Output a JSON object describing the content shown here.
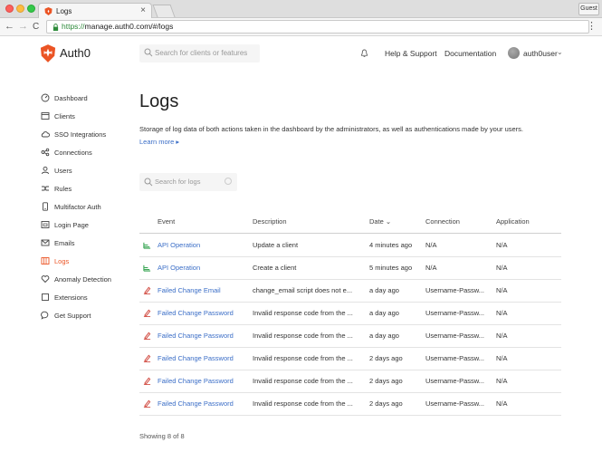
{
  "browser": {
    "tab_title": "Logs",
    "tab_close": "×",
    "guest_label": "Guest",
    "url_protocol": "https://",
    "url_rest": "manage.auth0.com/#/logs",
    "back": "←",
    "forward": "→",
    "reload": "C",
    "menu": "⋮",
    "lock": "🔒"
  },
  "header": {
    "logo_text": "Auth0",
    "search_placeholder": "Search for clients or features",
    "help_label": "Help & Support",
    "docs_label": "Documentation",
    "username": "auth0user",
    "user_chevron": "⌄"
  },
  "sidebar": {
    "items": [
      {
        "label": "Dashboard",
        "icon": "dashboard-icon"
      },
      {
        "label": "Clients",
        "icon": "clients-icon"
      },
      {
        "label": "SSO Integrations",
        "icon": "cloud-icon"
      },
      {
        "label": "Connections",
        "icon": "connections-icon"
      },
      {
        "label": "Users",
        "icon": "users-icon"
      },
      {
        "label": "Rules",
        "icon": "rules-icon"
      },
      {
        "label": "Multifactor Auth",
        "icon": "multifactor-icon"
      },
      {
        "label": "Login Page",
        "icon": "login-page-icon"
      },
      {
        "label": "Emails",
        "icon": "email-icon"
      },
      {
        "label": "Logs",
        "icon": "logs-icon",
        "active": true
      },
      {
        "label": "Anomaly Detection",
        "icon": "heart-icon"
      },
      {
        "label": "Extensions",
        "icon": "extensions-icon"
      },
      {
        "label": "Get Support",
        "icon": "chat-icon"
      }
    ]
  },
  "main": {
    "title": "Logs",
    "description": "Storage of log data of both actions taken in the dashboard by the administrators, as well as authentications made by your users.",
    "learn_more": "Learn more ▸",
    "search_placeholder": "Search for logs",
    "columns": {
      "event": "Event",
      "description": "Description",
      "date": "Date ⌄",
      "connection": "Connection",
      "application": "Application"
    },
    "rows": [
      {
        "type": "success",
        "event": "API Operation",
        "description": "Update a client",
        "date": "4 minutes ago",
        "connection": "N/A",
        "application": "N/A"
      },
      {
        "type": "success",
        "event": "API Operation",
        "description": "Create a client",
        "date": "5 minutes ago",
        "connection": "N/A",
        "application": "N/A"
      },
      {
        "type": "failure",
        "event": "Failed Change Email",
        "description": "change_email script does not e...",
        "date": "a day ago",
        "connection": "Username-Passw...",
        "application": "N/A"
      },
      {
        "type": "failure",
        "event": "Failed Change Password",
        "description": "Invalid response code from the ...",
        "date": "a day ago",
        "connection": "Username-Passw...",
        "application": "N/A"
      },
      {
        "type": "failure",
        "event": "Failed Change Password",
        "description": "Invalid response code from the ...",
        "date": "a day ago",
        "connection": "Username-Passw...",
        "application": "N/A"
      },
      {
        "type": "failure",
        "event": "Failed Change Password",
        "description": "Invalid response code from the ...",
        "date": "2 days ago",
        "connection": "Username-Passw...",
        "application": "N/A"
      },
      {
        "type": "failure",
        "event": "Failed Change Password",
        "description": "Invalid response code from the ...",
        "date": "2 days ago",
        "connection": "Username-Passw...",
        "application": "N/A"
      },
      {
        "type": "failure",
        "event": "Failed Change Password",
        "description": "Invalid response code from the ...",
        "date": "2 days ago",
        "connection": "Username-Passw...",
        "application": "N/A"
      }
    ],
    "footer": "Showing 8 of 8"
  },
  "colors": {
    "brand": "#eb5424",
    "link": "#3b6ec7",
    "success": "#3aa655",
    "failure": "#d0453b"
  }
}
